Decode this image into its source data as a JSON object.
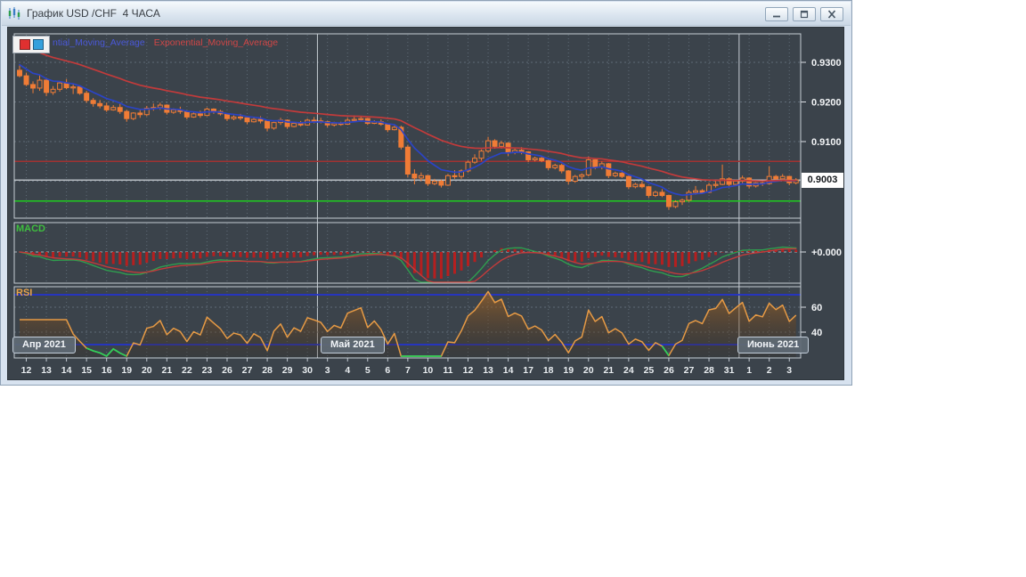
{
  "window": {
    "title": "График USD /CHF  4 ЧАСА",
    "controls": [
      "minimize",
      "restore",
      "close"
    ]
  },
  "legend": {
    "buttons": [
      "red-indicator-button",
      "blue-indicator-button"
    ],
    "items": [
      {
        "label": "ntial_Moving_Average",
        "color": "#4A58D8"
      },
      {
        "label": "Exponential_Moving_Average",
        "color": "#CF4646"
      }
    ]
  },
  "panels": {
    "macd_label": "MACD",
    "rsi_label": "RSI"
  },
  "axis": {
    "current_price": "0.9003"
  },
  "flags": [
    "Апр 2021",
    "Май 2021",
    "Июнь 2021"
  ],
  "theme": {
    "chart_bg": "#3B434B",
    "grid": "#5F6B77",
    "panel_border": "#C6CCD3",
    "candle": "#F07C36",
    "ema_fast": "#2B44C4",
    "ema_slow": "#C23B3B",
    "macd_bar": "#B51F1F",
    "macd_line": "#2F9E4F",
    "macd_signal": "#C23B3B",
    "rsi_line": "#E69A45",
    "rsi_band": "#2433CE",
    "rsi_oversold": "#2FD05A",
    "resistance": "#A03232",
    "support": "#1FCC1F",
    "current_line": "#DFE3E7",
    "axis_text": "#F2F4F6",
    "macd_label_color": "#3FBF3F",
    "rsi_label_color": "#E8A24A"
  },
  "chart_data": {
    "type": "candlestick",
    "title": "USD/CHF 4H",
    "timeframe": "4 ЧАСА",
    "x_labels": [
      "12",
      "13",
      "14",
      "15",
      "16",
      "19",
      "20",
      "21",
      "22",
      "23",
      "26",
      "27",
      "28",
      "29",
      "30",
      "3",
      "4",
      "5",
      "6",
      "7",
      "10",
      "11",
      "12",
      "13",
      "14",
      "17",
      "18",
      "19",
      "20",
      "21",
      "24",
      "25",
      "26",
      "27",
      "28",
      "31",
      "1",
      "2",
      "3"
    ],
    "months": [
      {
        "label": "Апр 2021",
        "day_index": 0
      },
      {
        "label": "Май 2021",
        "day_index": 15
      },
      {
        "label": "Июнь 2021",
        "day_index": 36
      }
    ],
    "candles_per_day": 3,
    "price_axis": {
      "tick_labels": [
        "0.9300",
        "0.9200",
        "0.9100"
      ],
      "tick_values": [
        0.93,
        0.92,
        0.91
      ],
      "grid_values": [
        0.93,
        0.92,
        0.91,
        0.9
      ],
      "current": 0.9003
    },
    "levels": {
      "resistance": 0.905,
      "support": 0.895,
      "current": 0.9003
    },
    "indicators": {
      "ema_fast": {
        "period": 8,
        "seed": 0.9302
      },
      "ema_slow": {
        "period": 30,
        "seed": 0.9347
      },
      "macd": {
        "fast": 6,
        "slow": 18,
        "smooth": 3,
        "signal": 7,
        "zero_label": "+0.000"
      },
      "rsi": {
        "period": 7,
        "band_levels": [
          70,
          30
        ],
        "tick_labels": [
          "60",
          "40"
        ],
        "tick_values": [
          60,
          40
        ]
      }
    },
    "ohlc": [
      [
        0.928,
        0.9292,
        0.9262,
        0.9266
      ],
      [
        0.9266,
        0.9274,
        0.924,
        0.9244
      ],
      [
        0.9244,
        0.9252,
        0.9222,
        0.9235
      ],
      [
        0.9235,
        0.9268,
        0.9228,
        0.9255
      ],
      [
        0.9255,
        0.926,
        0.9215,
        0.9224
      ],
      [
        0.9224,
        0.924,
        0.9218,
        0.9232
      ],
      [
        0.9232,
        0.9252,
        0.9226,
        0.9248
      ],
      [
        0.9248,
        0.9258,
        0.9232,
        0.9236
      ],
      [
        0.9236,
        0.9244,
        0.922,
        0.9238
      ],
      [
        0.9238,
        0.9242,
        0.9218,
        0.9222
      ],
      [
        0.9222,
        0.9228,
        0.9198,
        0.9204
      ],
      [
        0.9204,
        0.921,
        0.9188,
        0.9196
      ],
      [
        0.9196,
        0.9205,
        0.9184,
        0.919
      ],
      [
        0.919,
        0.9198,
        0.9175,
        0.918
      ],
      [
        0.918,
        0.9192,
        0.9178,
        0.9186
      ],
      [
        0.9186,
        0.9195,
        0.917,
        0.9176
      ],
      [
        0.9176,
        0.918,
        0.915,
        0.9158
      ],
      [
        0.9158,
        0.9174,
        0.9154,
        0.9172
      ],
      [
        0.9172,
        0.918,
        0.916,
        0.9168
      ],
      [
        0.9168,
        0.919,
        0.9164,
        0.9184
      ],
      [
        0.9184,
        0.9196,
        0.9178,
        0.9186
      ],
      [
        0.9186,
        0.9198,
        0.918,
        0.9192
      ],
      [
        0.9192,
        0.9194,
        0.9168,
        0.9174
      ],
      [
        0.9174,
        0.9184,
        0.917,
        0.918
      ],
      [
        0.918,
        0.9188,
        0.917,
        0.9176
      ],
      [
        0.9176,
        0.9178,
        0.9156,
        0.9162
      ],
      [
        0.9162,
        0.9174,
        0.916,
        0.917
      ],
      [
        0.917,
        0.9178,
        0.916,
        0.9166
      ],
      [
        0.9166,
        0.9186,
        0.9164,
        0.9182
      ],
      [
        0.9182,
        0.9184,
        0.917,
        0.9176
      ],
      [
        0.9176,
        0.918,
        0.9166,
        0.917
      ],
      [
        0.917,
        0.9172,
        0.9152,
        0.9158
      ],
      [
        0.9158,
        0.9166,
        0.9154,
        0.9162
      ],
      [
        0.9162,
        0.917,
        0.9154,
        0.916
      ],
      [
        0.916,
        0.9162,
        0.9144,
        0.915
      ],
      [
        0.915,
        0.916,
        0.9148,
        0.9156
      ],
      [
        0.9156,
        0.9164,
        0.9146,
        0.9152
      ],
      [
        0.9152,
        0.9154,
        0.9126,
        0.9134
      ],
      [
        0.9134,
        0.915,
        0.913,
        0.9148
      ],
      [
        0.9148,
        0.916,
        0.9142,
        0.9154
      ],
      [
        0.9154,
        0.9156,
        0.9132,
        0.9138
      ],
      [
        0.9138,
        0.9148,
        0.9136,
        0.9146
      ],
      [
        0.9146,
        0.9152,
        0.9138,
        0.9142
      ],
      [
        0.9142,
        0.9158,
        0.914,
        0.9154
      ],
      [
        0.9154,
        0.9162,
        0.9146,
        0.9152
      ],
      [
        0.9152,
        0.916,
        0.9146,
        0.915
      ],
      [
        0.915,
        0.9152,
        0.9136,
        0.9142
      ],
      [
        0.9142,
        0.915,
        0.9138,
        0.9146
      ],
      [
        0.9146,
        0.915,
        0.914,
        0.9144
      ],
      [
        0.9144,
        0.916,
        0.9142,
        0.9154
      ],
      [
        0.9154,
        0.9166,
        0.915,
        0.9156
      ],
      [
        0.9156,
        0.9164,
        0.915,
        0.9158
      ],
      [
        0.9158,
        0.916,
        0.9142,
        0.9146
      ],
      [
        0.9146,
        0.9154,
        0.9144,
        0.915
      ],
      [
        0.915,
        0.9156,
        0.914,
        0.9144
      ],
      [
        0.9144,
        0.9146,
        0.9124,
        0.913
      ],
      [
        0.913,
        0.914,
        0.9128,
        0.9136
      ],
      [
        0.9136,
        0.914,
        0.908,
        0.9086
      ],
      [
        0.9086,
        0.9092,
        0.901,
        0.9018
      ],
      [
        0.9018,
        0.903,
        0.8992,
        0.9008
      ],
      [
        0.9008,
        0.9022,
        0.9,
        0.9014
      ],
      [
        0.9014,
        0.9016,
        0.8988,
        0.8994
      ],
      [
        0.8994,
        0.9006,
        0.899,
        0.9
      ],
      [
        0.9,
        0.9004,
        0.8984,
        0.899
      ],
      [
        0.899,
        0.9018,
        0.8988,
        0.9014
      ],
      [
        0.9014,
        0.9028,
        0.9006,
        0.9012
      ],
      [
        0.9012,
        0.903,
        0.9006,
        0.9026
      ],
      [
        0.9026,
        0.9052,
        0.9022,
        0.9048
      ],
      [
        0.9048,
        0.9068,
        0.9044,
        0.9058
      ],
      [
        0.9058,
        0.908,
        0.9052,
        0.9076
      ],
      [
        0.9076,
        0.9112,
        0.9072,
        0.9102
      ],
      [
        0.9102,
        0.9106,
        0.9082,
        0.9088
      ],
      [
        0.9088,
        0.9102,
        0.9082,
        0.9096
      ],
      [
        0.9096,
        0.9098,
        0.9064,
        0.9072
      ],
      [
        0.9072,
        0.9082,
        0.9068,
        0.9078
      ],
      [
        0.9078,
        0.9086,
        0.9068,
        0.9074
      ],
      [
        0.9074,
        0.9076,
        0.9048,
        0.9054
      ],
      [
        0.9054,
        0.9062,
        0.905,
        0.9058
      ],
      [
        0.9058,
        0.9064,
        0.9048,
        0.9052
      ],
      [
        0.9052,
        0.9054,
        0.9028,
        0.9034
      ],
      [
        0.9034,
        0.9044,
        0.903,
        0.904
      ],
      [
        0.904,
        0.9044,
        0.902,
        0.9026
      ],
      [
        0.9026,
        0.9028,
        0.8992,
        0.9
      ],
      [
        0.9,
        0.9016,
        0.8996,
        0.9012
      ],
      [
        0.9012,
        0.902,
        0.9004,
        0.9016
      ],
      [
        0.9016,
        0.9062,
        0.9012,
        0.9054
      ],
      [
        0.9054,
        0.9058,
        0.903,
        0.9036
      ],
      [
        0.9036,
        0.905,
        0.903,
        0.9044
      ],
      [
        0.9044,
        0.9046,
        0.9008,
        0.9014
      ],
      [
        0.9014,
        0.9024,
        0.901,
        0.902
      ],
      [
        0.902,
        0.9028,
        0.9008,
        0.9012
      ],
      [
        0.9012,
        0.9014,
        0.898,
        0.8986
      ],
      [
        0.8986,
        0.8996,
        0.8982,
        0.8992
      ],
      [
        0.8992,
        0.9,
        0.8982,
        0.8986
      ],
      [
        0.8986,
        0.8988,
        0.8958,
        0.8964
      ],
      [
        0.8964,
        0.8976,
        0.896,
        0.8972
      ],
      [
        0.8972,
        0.898,
        0.896,
        0.8964
      ],
      [
        0.8964,
        0.8966,
        0.8928,
        0.8936
      ],
      [
        0.8936,
        0.8952,
        0.8932,
        0.8948
      ],
      [
        0.8948,
        0.8956,
        0.894,
        0.8952
      ],
      [
        0.8952,
        0.8978,
        0.8948,
        0.8972
      ],
      [
        0.8972,
        0.8988,
        0.8966,
        0.8976
      ],
      [
        0.8976,
        0.898,
        0.8968,
        0.8972
      ],
      [
        0.8972,
        0.8996,
        0.897,
        0.899
      ],
      [
        0.899,
        0.9002,
        0.8984,
        0.8992
      ],
      [
        0.8992,
        0.9042,
        0.899,
        0.9006
      ],
      [
        0.9006,
        0.901,
        0.8984,
        0.8992
      ],
      [
        0.8992,
        0.9004,
        0.8988,
        0.9
      ],
      [
        0.9,
        0.9014,
        0.8994,
        0.9008
      ],
      [
        0.9008,
        0.901,
        0.8982,
        0.8988
      ],
      [
        0.8988,
        0.8998,
        0.8984,
        0.8996
      ],
      [
        0.8996,
        0.9,
        0.8988,
        0.8994
      ],
      [
        0.8994,
        0.9038,
        0.8992,
        0.9012
      ],
      [
        0.9012,
        0.9016,
        0.8998,
        0.9006
      ],
      [
        0.9006,
        0.9018,
        0.9,
        0.9012
      ],
      [
        0.9012,
        0.9014,
        0.899,
        0.8996
      ],
      [
        0.8996,
        0.9008,
        0.8992,
        0.9003
      ]
    ]
  }
}
